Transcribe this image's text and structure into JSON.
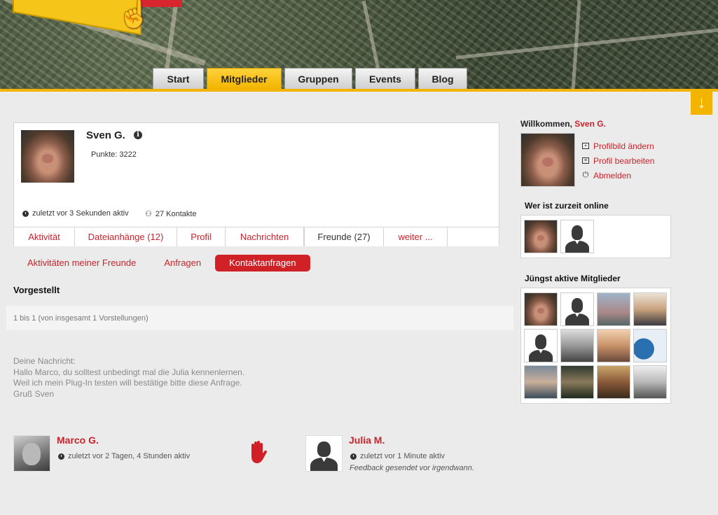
{
  "nav": {
    "tabs": [
      {
        "label": "Start",
        "active": false
      },
      {
        "label": "Mitglieder",
        "active": true
      },
      {
        "label": "Gruppen",
        "active": false
      },
      {
        "label": "Events",
        "active": false
      },
      {
        "label": "Blog",
        "active": false
      }
    ]
  },
  "colors": {
    "accent": "#f2b400",
    "brand_red": "#c8242b",
    "button_red": "#d02127"
  },
  "profile": {
    "name": "Sven G.",
    "points": "Punkte: 3222",
    "last_active": "zuletzt vor 3 Sekunden aktiv",
    "contacts": "27 Kontakte",
    "tabs": [
      {
        "label": "Aktivität",
        "active": false
      },
      {
        "label": "Dateianhänge (12)",
        "active": false
      },
      {
        "label": "Profil",
        "active": false
      },
      {
        "label": "Nachrichten",
        "active": false
      },
      {
        "label": "Freunde (27)",
        "active": true
      },
      {
        "label": "weiter ...",
        "active": false
      }
    ]
  },
  "subtabs": [
    {
      "label": "Aktivitäten meiner Freunde",
      "active": false
    },
    {
      "label": "Anfragen",
      "active": false
    },
    {
      "label": "Kontaktanfragen",
      "active": true
    }
  ],
  "section": {
    "title": "Vorgestellt",
    "count": "1 bis 1 (von insgesamt 1 Vorstellungen)"
  },
  "message": {
    "lines": [
      "Deine Nachricht:",
      "Hallo Marco, du solltest unbedingt mal die Julia kennenlernen.",
      "Weil ich mein Plug-In testen will bestätige bitte diese Anfrage.",
      "Gruß Sven"
    ]
  },
  "people": {
    "left": {
      "name": "Marco G.",
      "last_active": "zuletzt vor 2 Tagen, 4 Stunden aktiv"
    },
    "right": {
      "name": "Julia M.",
      "last_active": "zuletzt vor 1 Minute aktiv",
      "feedback": "Feedback gesendet vor irgendwann."
    }
  },
  "sidebar": {
    "welcome_prefix": "Willkommen,",
    "welcome_user": "Sven G.",
    "links": [
      {
        "label": "Profilbild ändern",
        "icon": "picture-icon"
      },
      {
        "label": "Profil bearbeiten",
        "icon": "edit-profile-icon"
      },
      {
        "label": "Abmelden",
        "icon": "power-icon"
      }
    ],
    "online_title": "Wer ist zurzeit online",
    "recent_title": "Jüngst aktive Mitglieder"
  }
}
